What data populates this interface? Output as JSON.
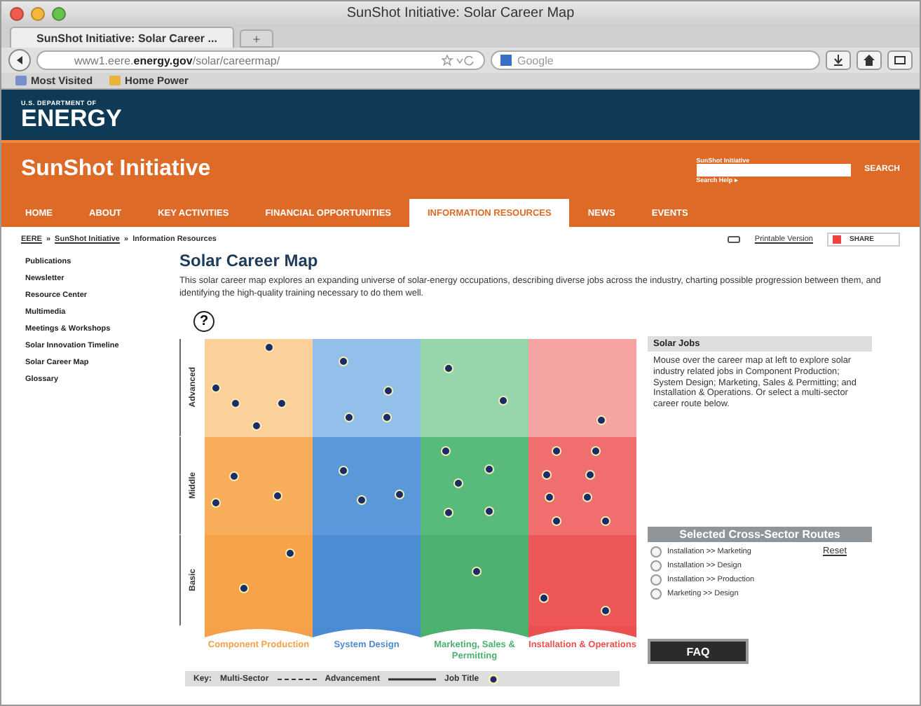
{
  "browser": {
    "title": "SunShot Initiative: Solar Career Map",
    "tab": "SunShot Initiative: Solar Career ...",
    "new_tab": "+",
    "url_plain": "www1.eere.",
    "url_bold": "energy.gov",
    "url_rest": "/solar/careermap/",
    "search_placeholder": "Google",
    "bookmarks": [
      "Most Visited",
      "Home Power"
    ]
  },
  "site": {
    "agency_line": "U.S. DEPARTMENT OF",
    "agency": "ENERGY",
    "title": "SunShot Initiative",
    "search": {
      "label": "SunShot Initiative",
      "button": "SEARCH",
      "help": "Search Help ▸"
    },
    "nav": [
      {
        "label": "HOME",
        "selected": false
      },
      {
        "label": "ABOUT",
        "selected": false
      },
      {
        "label": "KEY ACTIVITIES",
        "selected": false
      },
      {
        "label": "FINANCIAL OPPORTUNITIES",
        "selected": false
      },
      {
        "label": "INFORMATION RESOURCES",
        "selected": true
      },
      {
        "label": "NEWS",
        "selected": false
      },
      {
        "label": "EVENTS",
        "selected": false
      }
    ]
  },
  "breadcrumb": {
    "separator": "»",
    "items": [
      {
        "label": "EERE",
        "link": true
      },
      {
        "label": "SunShot Initiative",
        "link": true
      },
      {
        "label": "Information Resources",
        "link": false
      }
    ]
  },
  "tools": {
    "printable": "Printable Version",
    "share": "SHARE"
  },
  "sidebar": {
    "items": [
      "Publications",
      "Newsletter",
      "Resource Center",
      "Multimedia",
      "Meetings & Workshops",
      "Solar Innovation Timeline",
      "Solar Career Map",
      "Glossary"
    ]
  },
  "heading": "Solar Career Map",
  "intro": "This solar career map explores an expanding universe of solar-energy occupations, describing diverse jobs across the industry, charting possible progression between them, and identifying the high-quality training necessary to do them well.",
  "map": {
    "help": "?",
    "levels": [
      "Advanced",
      "Middle",
      "Basic"
    ],
    "sectors": [
      {
        "label": "Component Production",
        "color": "#f5a04a"
      },
      {
        "label": "System Design",
        "color": "#4b8bd1"
      },
      {
        "label": "Marketing, Sales & Permitting",
        "color": "#4bb16f"
      },
      {
        "label": "Installation & Operations",
        "color": "#ea5050"
      }
    ],
    "key": {
      "label": "Key:",
      "items": [
        "Multi-Sector",
        "Advancement",
        "Job Title"
      ]
    }
  },
  "panel": {
    "jobs_title": "Solar Jobs",
    "jobs_text": "Mouse over the career map at left to explore solar industry related jobs in Component Production; System Design; Marketing, Sales & Permitting; and Installation & Operations. Or select a multi-sector career route below.",
    "routes_title": "Selected Cross-Sector Routes",
    "routes": [
      {
        "label": "Installation >> Marketing",
        "selected": false
      },
      {
        "label": "Installation >> Design",
        "selected": false
      },
      {
        "label": "Installation >> Production",
        "selected": false
      },
      {
        "label": "Marketing >> Design",
        "selected": false
      }
    ],
    "reset": "Reset",
    "faq": "FAQ"
  }
}
